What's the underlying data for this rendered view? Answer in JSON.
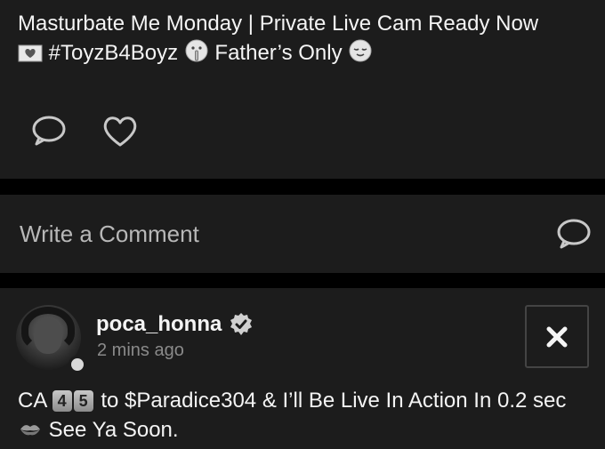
{
  "post": {
    "line1": "Masturbate Me Monday | Private Live Cam Ready Now",
    "hashtag": "#ToyzB4Boyz",
    "tail": "Father’s Only",
    "icons": [
      "heart-letter-icon",
      "shushing-face-icon",
      "relieved-face-icon"
    ]
  },
  "actions": {
    "icons": [
      "comment-icon",
      "heart-icon"
    ]
  },
  "comment_box": {
    "placeholder": "Write a Comment",
    "send_icon": "comment-icon"
  },
  "next_post": {
    "username": "poca_honna",
    "verified_icon": "verified-badge-icon",
    "timestamp": "2 mins ago",
    "close_icon": "close-icon",
    "text_prefix": "CA",
    "keycap_1": "4",
    "keycap_2": "5",
    "text_mid": "to $Paradice304 & I’ll Be Live In Action In 0.2 sec",
    "kiss_icon": "kiss-mark-icon",
    "text_tail": "See Ya Soon."
  },
  "colors": {
    "background": "#000000",
    "card": "#1c1c1c",
    "text": "#f4f4f4",
    "muted": "#8a8a8a"
  }
}
